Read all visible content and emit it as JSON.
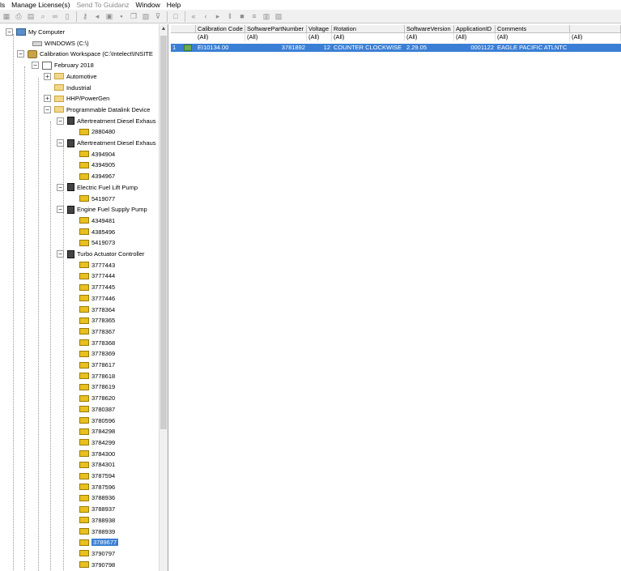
{
  "menu": [
    "ls",
    "Manage License(s)",
    "Send To Guidanz",
    "Window",
    "Help"
  ],
  "menu_disabled": [
    false,
    false,
    true,
    false,
    false
  ],
  "toolbar_icons": [
    "grid-icon",
    "print-icon",
    "preview-icon",
    "find-icon",
    "binoculars-icon",
    "doc-icon",
    "key-icon",
    "back-icon",
    "chip-icon",
    "save-icon",
    "copy-icon",
    "paste-icon",
    "filter-icon",
    "blank-icon",
    "rewind-icon",
    "stepback-icon",
    "play-icon",
    "pause-icon",
    "stop-icon",
    "bars-icon",
    "chart-icon",
    "report-icon"
  ],
  "tree": {
    "my_computer": "My Computer",
    "windows_drive": "WINDOWS  (C:\\)",
    "workspace": "Calibration Workspace  (C:\\Intelect\\INSITE",
    "month": "February 2018",
    "folders": [
      "Automotive",
      "Industrial",
      "HHP/PowerGen",
      "Programmable Datalink Device"
    ],
    "devices": [
      {
        "name": "Aftertreatment Diesel Exhaus",
        "items": [
          "2880480"
        ]
      },
      {
        "name": "Aftertreatment Diesel Exhaus",
        "items": [
          "4394904",
          "4394905",
          "4394967"
        ]
      },
      {
        "name": "Electric Fuel Lift Pump",
        "items": [
          "5419077"
        ]
      },
      {
        "name": "Engine Fuel Supply Pump",
        "items": [
          "4349481",
          "4385496",
          "5419073"
        ]
      },
      {
        "name": "Turbo Actuator Controller",
        "items": [
          "3777443",
          "3777444",
          "3777445",
          "3777446",
          "3778364",
          "3778365",
          "3778367",
          "3778368",
          "3778369",
          "3778617",
          "3778618",
          "3778619",
          "3778620",
          "3780387",
          "3780596",
          "3784298",
          "3784299",
          "3784300",
          "3784301",
          "3787594",
          "3787596",
          "3788936",
          "3788937",
          "3788938",
          "3788939",
          "3789677",
          "3790797",
          "3790798"
        ]
      }
    ],
    "selected_item": "3789677"
  },
  "grid": {
    "columns": [
      "Calibration Code",
      "SoftwarePartNumber",
      "Voltage",
      "Rotation",
      "SoftwareVersion",
      "ApplicationID",
      "Comments"
    ],
    "filter": [
      "(All)",
      "(All)",
      "(All)",
      "(All)",
      "(All)",
      "(All)",
      "(All)",
      "(All)"
    ],
    "rows": [
      {
        "index": "1",
        "calibration_code": "EI10134.00",
        "software_part_number": "3781892",
        "voltage": "12",
        "rotation": "COUNTER CLOCKWISE",
        "software_version": "2.29.05",
        "application_id": "0001122",
        "comments": "EAGLE PACIFIC ATLNTC"
      }
    ]
  },
  "colors": {
    "selection": "#3a7fd5",
    "toolbar": "#f0f0f0"
  }
}
